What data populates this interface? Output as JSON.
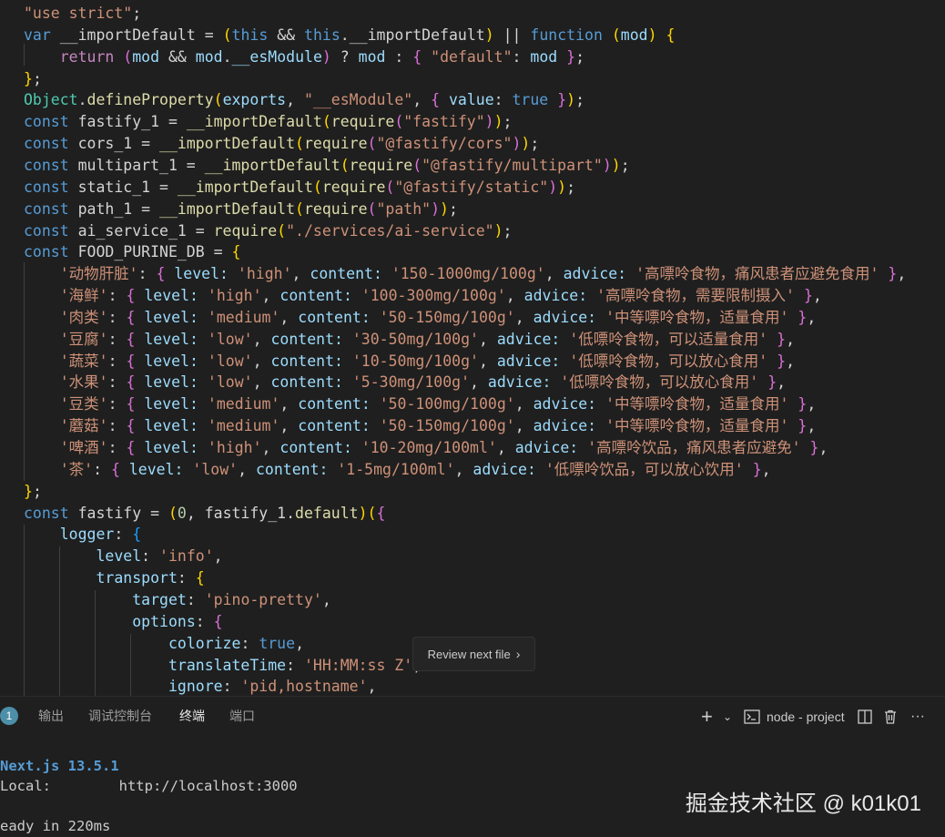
{
  "editor": {
    "lines": [
      [
        [
          "\"use strict\"",
          "t-str"
        ],
        [
          ";",
          "t-txt"
        ]
      ],
      [
        [
          "var",
          "t-kw"
        ],
        [
          " __importDefault ",
          "t-txt"
        ],
        [
          "=",
          "t-txt"
        ],
        [
          " ",
          "t-txt"
        ],
        [
          "(",
          "t-b1"
        ],
        [
          "this",
          "t-kw"
        ],
        [
          " && ",
          "t-txt"
        ],
        [
          "this",
          "t-kw"
        ],
        [
          ".",
          "t-txt"
        ],
        [
          "__importDefault",
          "t-txt"
        ],
        [
          ")",
          "t-b1"
        ],
        [
          " || ",
          "t-txt"
        ],
        [
          "function",
          "t-kw"
        ],
        [
          " ",
          "t-txt"
        ],
        [
          "(",
          "t-b1"
        ],
        [
          "mod",
          "t-var"
        ],
        [
          ")",
          "t-b1"
        ],
        [
          " ",
          "t-txt"
        ],
        [
          "{",
          "t-b1"
        ]
      ],
      [
        [
          "    ",
          "t-txt"
        ],
        [
          "return",
          "t-ctl"
        ],
        [
          " ",
          "t-txt"
        ],
        [
          "(",
          "t-b2"
        ],
        [
          "mod",
          "t-var"
        ],
        [
          " && ",
          "t-txt"
        ],
        [
          "mod",
          "t-var"
        ],
        [
          ".",
          "t-txt"
        ],
        [
          "__esModule",
          "t-var"
        ],
        [
          ")",
          "t-b2"
        ],
        [
          " ? ",
          "t-txt"
        ],
        [
          "mod",
          "t-var"
        ],
        [
          " : ",
          "t-txt"
        ],
        [
          "{",
          "t-b2"
        ],
        [
          " ",
          "t-txt"
        ],
        [
          "\"default\"",
          "t-str"
        ],
        [
          ": ",
          "t-txt"
        ],
        [
          "mod",
          "t-var"
        ],
        [
          " ",
          "t-txt"
        ],
        [
          "}",
          "t-b2"
        ],
        [
          ";",
          "t-txt"
        ]
      ],
      [
        [
          "}",
          "t-b1"
        ],
        [
          ";",
          "t-txt"
        ]
      ],
      [
        [
          "Object",
          "t-cls"
        ],
        [
          ".",
          "t-txt"
        ],
        [
          "defineProperty",
          "t-fn"
        ],
        [
          "(",
          "t-b1"
        ],
        [
          "exports",
          "t-var"
        ],
        [
          ", ",
          "t-txt"
        ],
        [
          "\"__esModule\"",
          "t-str"
        ],
        [
          ", ",
          "t-txt"
        ],
        [
          "{",
          "t-b2"
        ],
        [
          " ",
          "t-txt"
        ],
        [
          "value",
          "t-var"
        ],
        [
          ": ",
          "t-txt"
        ],
        [
          "true",
          "t-bool"
        ],
        [
          " ",
          "t-txt"
        ],
        [
          "}",
          "t-b2"
        ],
        [
          ")",
          "t-b1"
        ],
        [
          ";",
          "t-txt"
        ]
      ],
      [
        [
          "const",
          "t-kw"
        ],
        [
          " fastify_1 = ",
          "t-txt"
        ],
        [
          "__importDefault",
          "t-fn"
        ],
        [
          "(",
          "t-b1"
        ],
        [
          "require",
          "t-fn"
        ],
        [
          "(",
          "t-b2"
        ],
        [
          "\"fastify\"",
          "t-str"
        ],
        [
          ")",
          "t-b2"
        ],
        [
          ")",
          "t-b1"
        ],
        [
          ";",
          "t-txt"
        ]
      ],
      [
        [
          "const",
          "t-kw"
        ],
        [
          " cors_1 = ",
          "t-txt"
        ],
        [
          "__importDefault",
          "t-fn"
        ],
        [
          "(",
          "t-b1"
        ],
        [
          "require",
          "t-fn"
        ],
        [
          "(",
          "t-b2"
        ],
        [
          "\"@fastify/cors\"",
          "t-str"
        ],
        [
          ")",
          "t-b2"
        ],
        [
          ")",
          "t-b1"
        ],
        [
          ";",
          "t-txt"
        ]
      ],
      [
        [
          "const",
          "t-kw"
        ],
        [
          " multipart_1 = ",
          "t-txt"
        ],
        [
          "__importDefault",
          "t-fn"
        ],
        [
          "(",
          "t-b1"
        ],
        [
          "require",
          "t-fn"
        ],
        [
          "(",
          "t-b2"
        ],
        [
          "\"@fastify/multipart\"",
          "t-str"
        ],
        [
          ")",
          "t-b2"
        ],
        [
          ")",
          "t-b1"
        ],
        [
          ";",
          "t-txt"
        ]
      ],
      [
        [
          "const",
          "t-kw"
        ],
        [
          " static_1 = ",
          "t-txt"
        ],
        [
          "__importDefault",
          "t-fn"
        ],
        [
          "(",
          "t-b1"
        ],
        [
          "require",
          "t-fn"
        ],
        [
          "(",
          "t-b2"
        ],
        [
          "\"@fastify/static\"",
          "t-str"
        ],
        [
          ")",
          "t-b2"
        ],
        [
          ")",
          "t-b1"
        ],
        [
          ";",
          "t-txt"
        ]
      ],
      [
        [
          "const",
          "t-kw"
        ],
        [
          " path_1 = ",
          "t-txt"
        ],
        [
          "__importDefault",
          "t-fn"
        ],
        [
          "(",
          "t-b1"
        ],
        [
          "require",
          "t-fn"
        ],
        [
          "(",
          "t-b2"
        ],
        [
          "\"path\"",
          "t-str"
        ],
        [
          ")",
          "t-b2"
        ],
        [
          ")",
          "t-b1"
        ],
        [
          ";",
          "t-txt"
        ]
      ],
      [
        [
          "const",
          "t-kw"
        ],
        [
          " ai_service_1 = ",
          "t-txt"
        ],
        [
          "require",
          "t-fn"
        ],
        [
          "(",
          "t-b1"
        ],
        [
          "\"./services/ai-service\"",
          "t-str"
        ],
        [
          ")",
          "t-b1"
        ],
        [
          ";",
          "t-txt"
        ]
      ],
      [
        [
          "const",
          "t-kw"
        ],
        [
          " FOOD_PURINE_DB = ",
          "t-txt"
        ],
        [
          "{",
          "t-b1"
        ]
      ],
      [
        [
          "    ",
          "t-txt"
        ],
        [
          "'动物肝脏'",
          "t-str"
        ],
        [
          ": ",
          "t-txt"
        ],
        [
          "{",
          "t-b2"
        ],
        [
          " level: ",
          "t-var"
        ],
        [
          "'high'",
          "t-str"
        ],
        [
          ", ",
          "t-txt"
        ],
        [
          "content: ",
          "t-var"
        ],
        [
          "'150-1000mg/100g'",
          "t-str"
        ],
        [
          ", ",
          "t-txt"
        ],
        [
          "advice: ",
          "t-var"
        ],
        [
          "'高嘌呤食物，痛风患者应避免食用'",
          "t-str"
        ],
        [
          " ",
          "t-txt"
        ],
        [
          "}",
          "t-b2"
        ],
        [
          ",",
          "t-txt"
        ]
      ],
      [
        [
          "    ",
          "t-txt"
        ],
        [
          "'海鲜'",
          "t-str"
        ],
        [
          ": ",
          "t-txt"
        ],
        [
          "{",
          "t-b2"
        ],
        [
          " level: ",
          "t-var"
        ],
        [
          "'high'",
          "t-str"
        ],
        [
          ", ",
          "t-txt"
        ],
        [
          "content: ",
          "t-var"
        ],
        [
          "'100-300mg/100g'",
          "t-str"
        ],
        [
          ", ",
          "t-txt"
        ],
        [
          "advice: ",
          "t-var"
        ],
        [
          "'高嘌呤食物，需要限制摄入'",
          "t-str"
        ],
        [
          " ",
          "t-txt"
        ],
        [
          "}",
          "t-b2"
        ],
        [
          ",",
          "t-txt"
        ]
      ],
      [
        [
          "    ",
          "t-txt"
        ],
        [
          "'肉类'",
          "t-str"
        ],
        [
          ": ",
          "t-txt"
        ],
        [
          "{",
          "t-b2"
        ],
        [
          " level: ",
          "t-var"
        ],
        [
          "'medium'",
          "t-str"
        ],
        [
          ", ",
          "t-txt"
        ],
        [
          "content: ",
          "t-var"
        ],
        [
          "'50-150mg/100g'",
          "t-str"
        ],
        [
          ", ",
          "t-txt"
        ],
        [
          "advice: ",
          "t-var"
        ],
        [
          "'中等嘌呤食物，适量食用'",
          "t-str"
        ],
        [
          " ",
          "t-txt"
        ],
        [
          "}",
          "t-b2"
        ],
        [
          ",",
          "t-txt"
        ]
      ],
      [
        [
          "    ",
          "t-txt"
        ],
        [
          "'豆腐'",
          "t-str"
        ],
        [
          ": ",
          "t-txt"
        ],
        [
          "{",
          "t-b2"
        ],
        [
          " level: ",
          "t-var"
        ],
        [
          "'low'",
          "t-str"
        ],
        [
          ", ",
          "t-txt"
        ],
        [
          "content: ",
          "t-var"
        ],
        [
          "'30-50mg/100g'",
          "t-str"
        ],
        [
          ", ",
          "t-txt"
        ],
        [
          "advice: ",
          "t-var"
        ],
        [
          "'低嘌呤食物，可以适量食用'",
          "t-str"
        ],
        [
          " ",
          "t-txt"
        ],
        [
          "}",
          "t-b2"
        ],
        [
          ",",
          "t-txt"
        ]
      ],
      [
        [
          "    ",
          "t-txt"
        ],
        [
          "'蔬菜'",
          "t-str"
        ],
        [
          ": ",
          "t-txt"
        ],
        [
          "{",
          "t-b2"
        ],
        [
          " level: ",
          "t-var"
        ],
        [
          "'low'",
          "t-str"
        ],
        [
          ", ",
          "t-txt"
        ],
        [
          "content: ",
          "t-var"
        ],
        [
          "'10-50mg/100g'",
          "t-str"
        ],
        [
          ", ",
          "t-txt"
        ],
        [
          "advice: ",
          "t-var"
        ],
        [
          "'低嘌呤食物，可以放心食用'",
          "t-str"
        ],
        [
          " ",
          "t-txt"
        ],
        [
          "}",
          "t-b2"
        ],
        [
          ",",
          "t-txt"
        ]
      ],
      [
        [
          "    ",
          "t-txt"
        ],
        [
          "'水果'",
          "t-str"
        ],
        [
          ": ",
          "t-txt"
        ],
        [
          "{",
          "t-b2"
        ],
        [
          " level: ",
          "t-var"
        ],
        [
          "'low'",
          "t-str"
        ],
        [
          ", ",
          "t-txt"
        ],
        [
          "content: ",
          "t-var"
        ],
        [
          "'5-30mg/100g'",
          "t-str"
        ],
        [
          ", ",
          "t-txt"
        ],
        [
          "advice: ",
          "t-var"
        ],
        [
          "'低嘌呤食物，可以放心食用'",
          "t-str"
        ],
        [
          " ",
          "t-txt"
        ],
        [
          "}",
          "t-b2"
        ],
        [
          ",",
          "t-txt"
        ]
      ],
      [
        [
          "    ",
          "t-txt"
        ],
        [
          "'豆类'",
          "t-str"
        ],
        [
          ": ",
          "t-txt"
        ],
        [
          "{",
          "t-b2"
        ],
        [
          " level: ",
          "t-var"
        ],
        [
          "'medium'",
          "t-str"
        ],
        [
          ", ",
          "t-txt"
        ],
        [
          "content: ",
          "t-var"
        ],
        [
          "'50-100mg/100g'",
          "t-str"
        ],
        [
          ", ",
          "t-txt"
        ],
        [
          "advice: ",
          "t-var"
        ],
        [
          "'中等嘌呤食物，适量食用'",
          "t-str"
        ],
        [
          " ",
          "t-txt"
        ],
        [
          "}",
          "t-b2"
        ],
        [
          ",",
          "t-txt"
        ]
      ],
      [
        [
          "    ",
          "t-txt"
        ],
        [
          "'蘑菇'",
          "t-str"
        ],
        [
          ": ",
          "t-txt"
        ],
        [
          "{",
          "t-b2"
        ],
        [
          " level: ",
          "t-var"
        ],
        [
          "'medium'",
          "t-str"
        ],
        [
          ", ",
          "t-txt"
        ],
        [
          "content: ",
          "t-var"
        ],
        [
          "'50-150mg/100g'",
          "t-str"
        ],
        [
          ", ",
          "t-txt"
        ],
        [
          "advice: ",
          "t-var"
        ],
        [
          "'中等嘌呤食物，适量食用'",
          "t-str"
        ],
        [
          " ",
          "t-txt"
        ],
        [
          "}",
          "t-b2"
        ],
        [
          ",",
          "t-txt"
        ]
      ],
      [
        [
          "    ",
          "t-txt"
        ],
        [
          "'啤酒'",
          "t-str"
        ],
        [
          ": ",
          "t-txt"
        ],
        [
          "{",
          "t-b2"
        ],
        [
          " level: ",
          "t-var"
        ],
        [
          "'high'",
          "t-str"
        ],
        [
          ", ",
          "t-txt"
        ],
        [
          "content: ",
          "t-var"
        ],
        [
          "'10-20mg/100ml'",
          "t-str"
        ],
        [
          ", ",
          "t-txt"
        ],
        [
          "advice: ",
          "t-var"
        ],
        [
          "'高嘌呤饮品，痛风患者应避免'",
          "t-str"
        ],
        [
          " ",
          "t-txt"
        ],
        [
          "}",
          "t-b2"
        ],
        [
          ",",
          "t-txt"
        ]
      ],
      [
        [
          "    ",
          "t-txt"
        ],
        [
          "'茶'",
          "t-str"
        ],
        [
          ": ",
          "t-txt"
        ],
        [
          "{",
          "t-b2"
        ],
        [
          " level: ",
          "t-var"
        ],
        [
          "'low'",
          "t-str"
        ],
        [
          ", ",
          "t-txt"
        ],
        [
          "content: ",
          "t-var"
        ],
        [
          "'1-5mg/100ml'",
          "t-str"
        ],
        [
          ", ",
          "t-txt"
        ],
        [
          "advice: ",
          "t-var"
        ],
        [
          "'低嘌呤饮品，可以放心饮用'",
          "t-str"
        ],
        [
          " ",
          "t-txt"
        ],
        [
          "}",
          "t-b2"
        ],
        [
          ",",
          "t-txt"
        ]
      ],
      [
        [
          "}",
          "t-b1"
        ],
        [
          ";",
          "t-txt"
        ]
      ],
      [
        [
          "const",
          "t-kw"
        ],
        [
          " fastify = ",
          "t-txt"
        ],
        [
          "(",
          "t-b1"
        ],
        [
          "0",
          "t-num"
        ],
        [
          ", fastify_1.",
          "t-txt"
        ],
        [
          "default",
          "t-fn"
        ],
        [
          ")",
          "t-b1"
        ],
        [
          "(",
          "t-b1"
        ],
        [
          "{",
          "t-b2"
        ]
      ],
      [
        [
          "    ",
          "t-txt"
        ],
        [
          "logger",
          "t-var"
        ],
        [
          ": ",
          "t-txt"
        ],
        [
          "{",
          "t-b3"
        ]
      ],
      [
        [
          "        ",
          "t-txt"
        ],
        [
          "level",
          "t-var"
        ],
        [
          ": ",
          "t-txt"
        ],
        [
          "'info'",
          "t-str"
        ],
        [
          ",",
          "t-txt"
        ]
      ],
      [
        [
          "        ",
          "t-txt"
        ],
        [
          "transport",
          "t-var"
        ],
        [
          ": ",
          "t-txt"
        ],
        [
          "{",
          "t-b1"
        ]
      ],
      [
        [
          "            ",
          "t-txt"
        ],
        [
          "target",
          "t-var"
        ],
        [
          ": ",
          "t-txt"
        ],
        [
          "'pino-pretty'",
          "t-str"
        ],
        [
          ",",
          "t-txt"
        ]
      ],
      [
        [
          "            ",
          "t-txt"
        ],
        [
          "options",
          "t-var"
        ],
        [
          ": ",
          "t-txt"
        ],
        [
          "{",
          "t-b2"
        ]
      ],
      [
        [
          "                ",
          "t-txt"
        ],
        [
          "colorize",
          "t-var"
        ],
        [
          ": ",
          "t-txt"
        ],
        [
          "true",
          "t-bool"
        ],
        [
          ",",
          "t-txt"
        ]
      ],
      [
        [
          "                ",
          "t-txt"
        ],
        [
          "translateTime",
          "t-var"
        ],
        [
          ": ",
          "t-txt"
        ],
        [
          "'HH:MM:ss Z'",
          "t-str"
        ],
        [
          ",",
          "t-txt"
        ]
      ],
      [
        [
          "                ",
          "t-txt"
        ],
        [
          "ignore",
          "t-var"
        ],
        [
          ": ",
          "t-txt"
        ],
        [
          "'pid,hostname'",
          "t-str"
        ],
        [
          ",",
          "t-txt"
        ]
      ]
    ]
  },
  "review_button": {
    "label": "Review next file",
    "icon": "chevron-right-icon"
  },
  "panel": {
    "badge_count": "1",
    "tabs": [
      "输出",
      "调试控制台",
      "终端",
      "端口"
    ],
    "active_tab": "终端",
    "terminal_name": "node - project",
    "icons": [
      "plus-icon",
      "chevron-down-icon",
      "terminal-icon",
      "split-icon",
      "trash-icon",
      "more-icon"
    ]
  },
  "terminal": {
    "lines": [
      "Next.js 13.5.1",
      "Local:        http://localhost:3000",
      "",
      "eady in 220ms"
    ]
  },
  "watermark": "掘金技术社区 @ k01k01",
  "colors": {
    "background": "#1f1f1f",
    "string": "#ce9178",
    "keyword": "#569cd6",
    "function": "#dcdcaa",
    "variable": "#9cdcfe"
  }
}
